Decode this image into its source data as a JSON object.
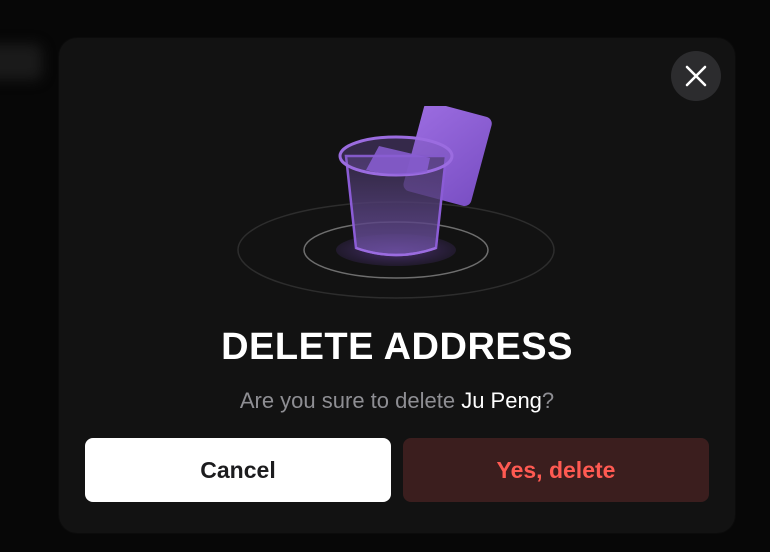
{
  "dialog": {
    "title": "DELETE ADDRESS",
    "message_prefix": "Are you sure to delete ",
    "address_name": "Ju Peng",
    "message_suffix": "?",
    "cancel_label": "Cancel",
    "confirm_label": "Yes, delete",
    "close_icon": "close-icon",
    "illustration_icon": "trash-bin-icon"
  },
  "colors": {
    "accent_purple": "#8b5cd6",
    "danger_text": "#ff5a52",
    "danger_bg": "#3b1e1e"
  }
}
